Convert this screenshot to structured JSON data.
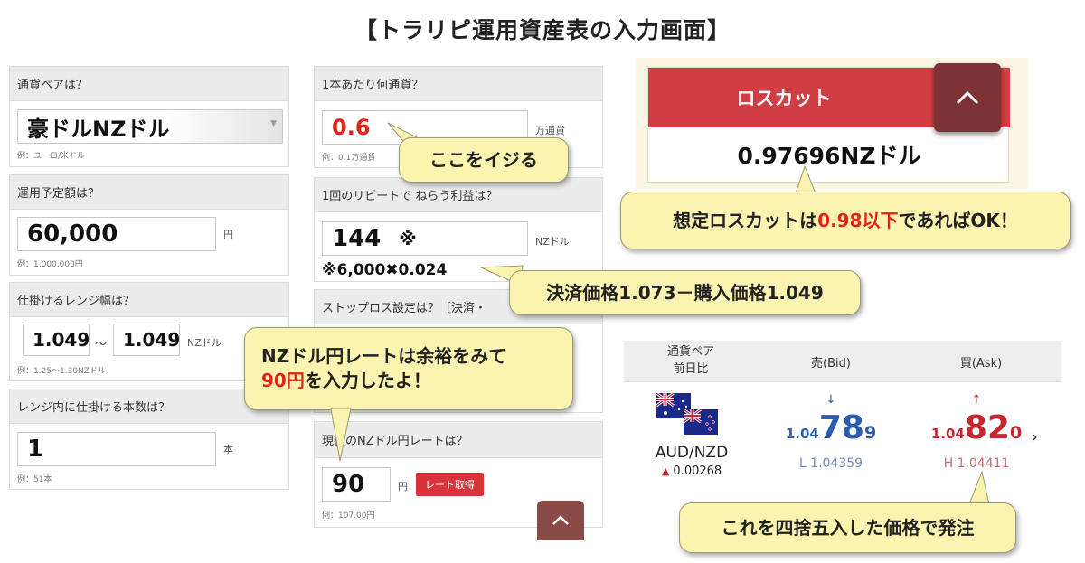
{
  "title": "【トラリピ運用資産表の入力画面】",
  "col1": {
    "pair": {
      "header": "通貨ペアは？",
      "value": "豪ドルNZドル",
      "example": "例：ユーロ/米ドル"
    },
    "amount": {
      "header": "運用予定額は？",
      "value": "60,000",
      "unit": "円",
      "example": "例：1,000,000円"
    },
    "range": {
      "header": "仕掛けるレンジ幅は？",
      "low": "1.049",
      "sep": "〜",
      "high": "1.049",
      "unit": "NZドル",
      "example": "例：1.25〜1.30NZドル"
    },
    "count": {
      "header": "レンジ内に仕掛ける本数は？",
      "value": "1",
      "unit": "本",
      "example": "例：51本"
    }
  },
  "col2": {
    "units": {
      "header": "1本あたり何通貨？",
      "value": "0.6",
      "unit": "万通貨",
      "example": "例：0.1万通貨"
    },
    "profit": {
      "header": "1回のリピートで ねらう利益は？",
      "value": "144",
      "mark": "※",
      "unit": "NZドル",
      "note": "※6,000✖0.024"
    },
    "stoploss": {
      "header": "ストップロス設定は？［決済・"
    },
    "rate": {
      "header": "現在のNZドル円レートは？",
      "value": "90",
      "unit": "円",
      "button": "レート取得",
      "example": "例：107.00円"
    },
    "up_icon": "chevron-up"
  },
  "losscut": {
    "button": "ロスカット",
    "value": "0.97696NZドル",
    "collapse_icon": "chevron-up"
  },
  "callouts": {
    "c1": "ここをイジる",
    "c2_a": "想定ロスカットは",
    "c2_b": "0.98以下",
    "c2_c": "であればOK！",
    "c3": "決済価格1.073－購入価格1.049",
    "c4_line1": "NZドル円レートは余裕をみて",
    "c4_b": "90円",
    "c4_c": "を入力したよ！",
    "c5": "これを四捨五入した価格で発注"
  },
  "quote": {
    "header_pair_1": "通貨ペア",
    "header_pair_2": "前日比",
    "header_bid": "売(Bid)",
    "header_ask": "買(Ask)",
    "pair": "AUD/NZD",
    "change": "0.00268",
    "bid_prefix": "1.04",
    "bid_main": "78",
    "bid_sub": "9",
    "bid_low": "L 1.04359",
    "ask_prefix": "1.04",
    "ask_main": "82",
    "ask_sub": "0",
    "ask_high": "H 1.04411",
    "colors": {
      "bid": "#2a5db0",
      "ask": "#c8262d"
    }
  }
}
